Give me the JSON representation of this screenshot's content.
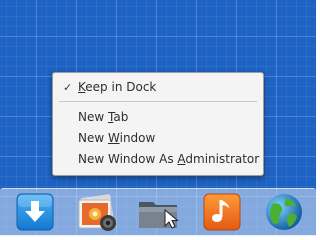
{
  "context_menu": {
    "keep_in_dock": {
      "checked": true,
      "check_glyph": "✓",
      "label_accel": "K",
      "label_rest": "eep in Dock"
    },
    "new_tab": {
      "label_pre": "New ",
      "label_accel": "T",
      "label_post": "ab"
    },
    "new_window": {
      "label_pre": "New ",
      "label_accel": "W",
      "label_post": "indow"
    },
    "new_window_admin": {
      "label_pre": "New Window As ",
      "label_accel": "A",
      "label_post": "dministrator"
    }
  },
  "dock": {
    "items": [
      {
        "icon": "download-icon",
        "color": "#1a8ce0"
      },
      {
        "icon": "photos-icon",
        "color": "#e8682a"
      },
      {
        "icon": "files-icon",
        "color": "#6b7684"
      },
      {
        "icon": "music-icon",
        "color": "#f07a28"
      },
      {
        "icon": "globe-icon",
        "color": "#3a8f2e"
      }
    ]
  },
  "colors": {
    "desktop_background": "#1e63c4",
    "menu_background": "#f4f4f4",
    "menu_text": "#2e2e2e"
  }
}
